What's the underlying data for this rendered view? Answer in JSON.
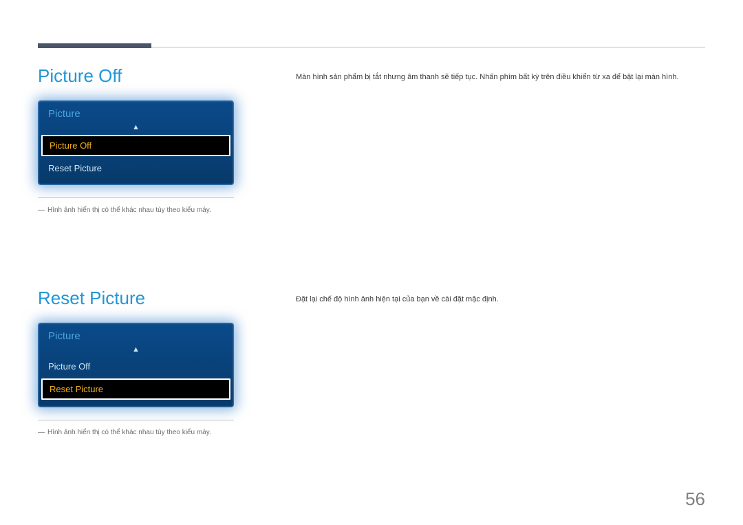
{
  "section1": {
    "title": "Picture Off",
    "description": "Màn hình sản phẩm bị tắt nhưng âm thanh sẽ tiếp tục. Nhấn phím bất kỳ trên điều khiển từ xa để bật lại màn hình.",
    "menu": {
      "header": "Picture",
      "items": [
        {
          "label": "Picture Off",
          "selected": true
        },
        {
          "label": "Reset Picture",
          "selected": false
        }
      ]
    },
    "note": "Hình ảnh hiển thị có thể khác nhau tùy theo kiểu máy."
  },
  "section2": {
    "title": "Reset Picture",
    "description": "Đặt lại chế độ hình ảnh hiện tại của bạn về cài đặt mặc định.",
    "menu": {
      "header": "Picture",
      "items": [
        {
          "label": "Picture Off",
          "selected": false
        },
        {
          "label": "Reset Picture",
          "selected": true
        }
      ]
    },
    "note": "Hình ảnh hiển thị có thể khác nhau tùy theo kiểu máy."
  },
  "pageNumber": "56"
}
